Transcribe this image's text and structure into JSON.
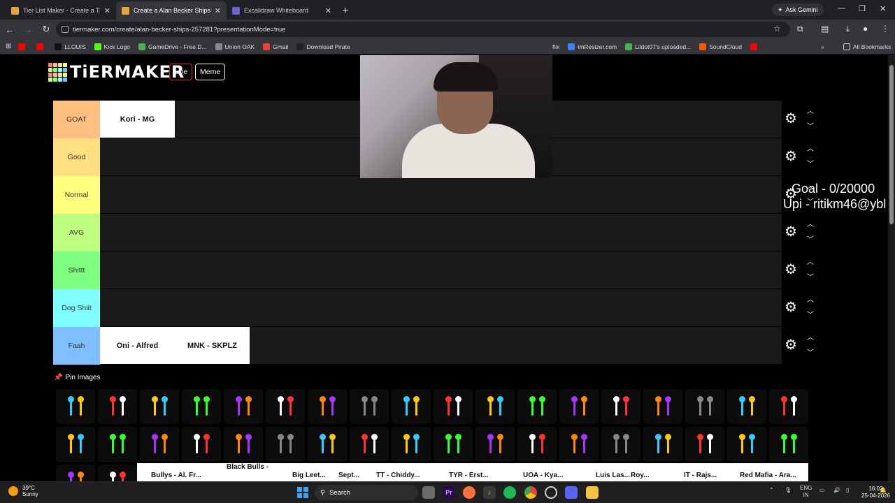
{
  "browser": {
    "tabs": [
      {
        "title": "Tier List Maker - Create a Tier L",
        "active": false,
        "favicon_color": "#e8a33c"
      },
      {
        "title": "Create a Alan Becker Ships Tier",
        "active": true,
        "favicon_color": "#e8a33c"
      },
      {
        "title": "Excalidraw Whiteboard",
        "active": false,
        "favicon_color": "#6965db"
      }
    ],
    "new_tab_label": "+",
    "gemini_label": "Ask Gemini",
    "url": "tiermaker.com/create/alan-becker-ships-257281?presentationMode=true",
    "bookmarks": [
      {
        "label": "",
        "color": "#ff0000"
      },
      {
        "label": "",
        "color": "#ff0000"
      },
      {
        "label": "LLOUIS",
        "color": "#111111"
      },
      {
        "label": "Kick Logo",
        "color": "#53fc18"
      },
      {
        "label": "GameDrive - Free D...",
        "color": "#4caf50"
      },
      {
        "label": "Union OAK",
        "color": "#888888"
      },
      {
        "label": "Gmail",
        "color": "#ea4335"
      },
      {
        "label": "Download Pirate",
        "color": "#222222"
      }
    ],
    "bookmarks_right": [
      {
        "label": "imResizer.com",
        "color": "#3b82f6"
      },
      {
        "label": "Lildot07's uploaded...",
        "color": "#4caf50"
      },
      {
        "label": "SoundCloud",
        "color": "#ff5500"
      },
      {
        "label": "",
        "color": "#ff0000"
      }
    ],
    "bookmark_partial": "flix",
    "all_bookmarks": "All Bookmarks"
  },
  "site": {
    "logo_text": "TiERMAKER",
    "logo_colors": [
      "#ff7f7f",
      "#ffbf7f",
      "#ffdf7f",
      "#ffff7f",
      "#bfff7f",
      "#7fff7f",
      "#7fffff",
      "#7fbfff",
      "#ff7f7f",
      "#ffbf7f",
      "#ffdf7f",
      "#ffff7f",
      "#bfff7f",
      "#7fff7f",
      "#7fffff",
      "#7fbfff"
    ],
    "live_label": "Live",
    "meme_label": "Meme"
  },
  "tiers": [
    {
      "label": "GOAT",
      "color": "#ffbf7f",
      "items": [
        "Kori - MG"
      ]
    },
    {
      "label": "Good",
      "color": "#ffdf7f",
      "items": []
    },
    {
      "label": "Normal",
      "color": "#ffff7f",
      "items": []
    },
    {
      "label": "AVG",
      "color": "#bfff7f",
      "items": []
    },
    {
      "label": "Shittt",
      "color": "#7fff7f",
      "items": []
    },
    {
      "label": "Dog Shiit",
      "color": "#7fffff",
      "items": []
    },
    {
      "label": "Faah",
      "color": "#7fbfff",
      "items": [
        "Oni - Alfred",
        "MNK - SKPLZ"
      ]
    }
  ],
  "stream_overlay": {
    "goal": "Goal - 0/20000",
    "upi": "Upi - ritikm46@ybl"
  },
  "pin_images_label": "Pin Images",
  "bottom_cards": [
    "Bullys - Al. Fr...",
    "Black Bulls -",
    "Big Leet...",
    "Sept...",
    "TT - Chiddy...",
    "TYR - Erst...",
    "UOA - Kya...",
    "Luis Las...",
    "Roy...",
    "IT - Rajs...",
    "Red Mafia - Ara..."
  ],
  "taskbar": {
    "temperature": "39°C",
    "weather": "Sunny",
    "search_label": "Search",
    "lang_top": "ENG",
    "lang_bottom": "IN",
    "time": "16:02",
    "date": "25-04-2026"
  }
}
